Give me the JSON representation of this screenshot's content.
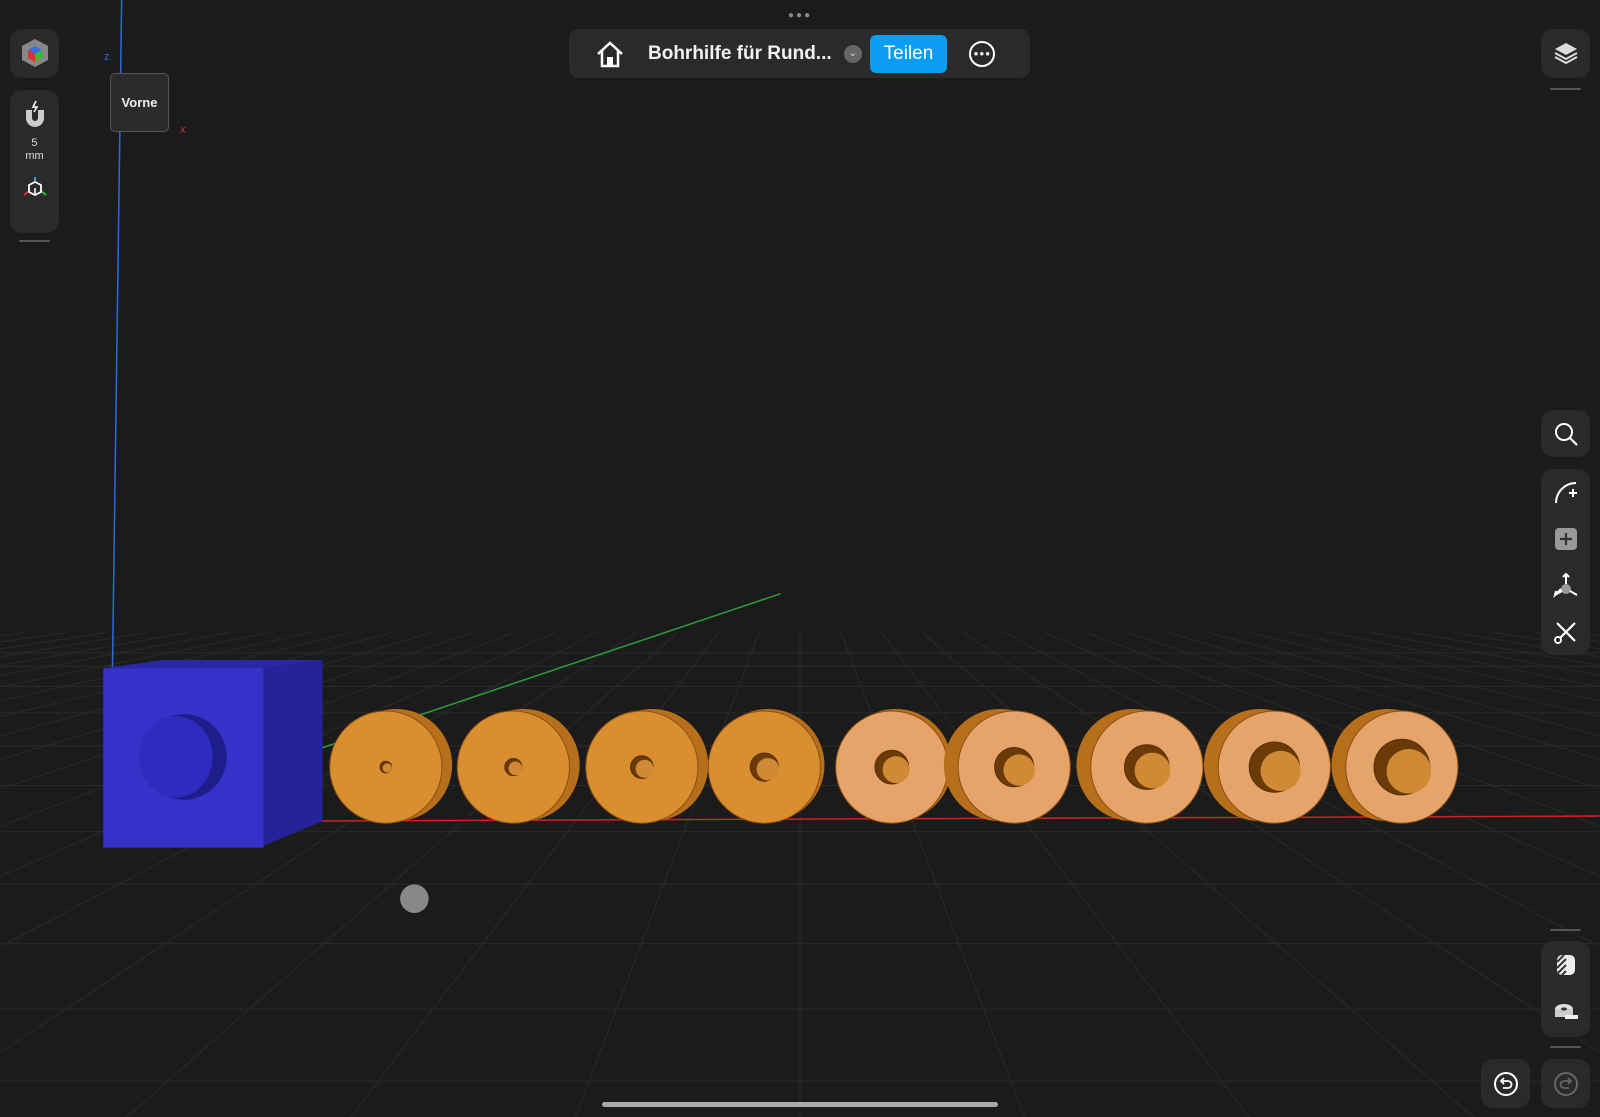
{
  "toolbar": {
    "title": "Bohrhilfe für Rund...",
    "share_label": "Teilen"
  },
  "left_panel": {
    "snap_value": "5",
    "snap_unit": "mm"
  },
  "view_cube": {
    "label": "Vorne",
    "axis_z": "z",
    "axis_x": "x"
  },
  "colors": {
    "accent": "#0a9cf0",
    "cube": "#3432c8",
    "disc": "#d98e30",
    "disc_light": "#e6a46a"
  },
  "scene": {
    "hole_sizes_relative": [
      1,
      2,
      3,
      4,
      5,
      6,
      7,
      8,
      9
    ]
  }
}
